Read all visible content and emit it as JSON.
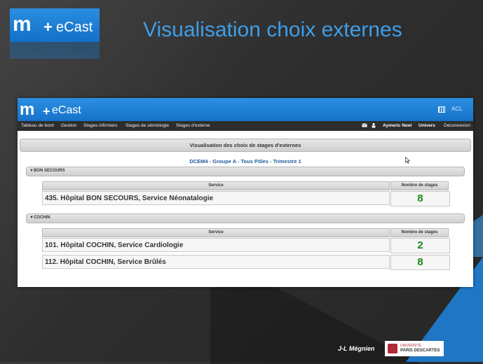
{
  "slide": {
    "logo": {
      "mark": "m",
      "plus": "+",
      "text": "eCast"
    },
    "title": "Visualisation choix externes",
    "author": "J-L Mégnien",
    "university": {
      "line1": "UNIVERSITÉ",
      "line2": "PARIS DESCARTES"
    }
  },
  "app": {
    "logo": {
      "mark": "m",
      "plus": "+",
      "text": "eCast"
    },
    "acl_label": "ACL",
    "nav": {
      "items": [
        "Tableau de bord",
        "Gestion",
        "Stages infirmiers",
        "Stages de sémiologie",
        "Stages d'externe"
      ],
      "user": "Aymeric Noel",
      "univers": "Univers",
      "logout": "Déconnexion"
    },
    "page_heading": "Visualisation des choix de stages d'externes",
    "subtitle": "DCEM4 - Groupe A - Tous Pôles - Trimestre 1",
    "columns": {
      "service": "Service",
      "count": "Nombre de stages"
    },
    "sections": [
      {
        "name": "▼BON SECOURS",
        "rows": [
          {
            "service": "435. Hôpital BON SECOURS, Service Néonatalogie",
            "count": "8"
          }
        ]
      },
      {
        "name": "▼COCHIN",
        "rows": [
          {
            "service": "101. Hôpital COCHIN, Service Cardiologie",
            "count": "2"
          },
          {
            "service": "112. Hôpital COCHIN, Service Brûlés",
            "count": "8"
          }
        ]
      }
    ]
  },
  "colors": {
    "title": "#3e9ee8",
    "header_blue": "#1e82d8",
    "count_green": "#1a8a1a"
  }
}
